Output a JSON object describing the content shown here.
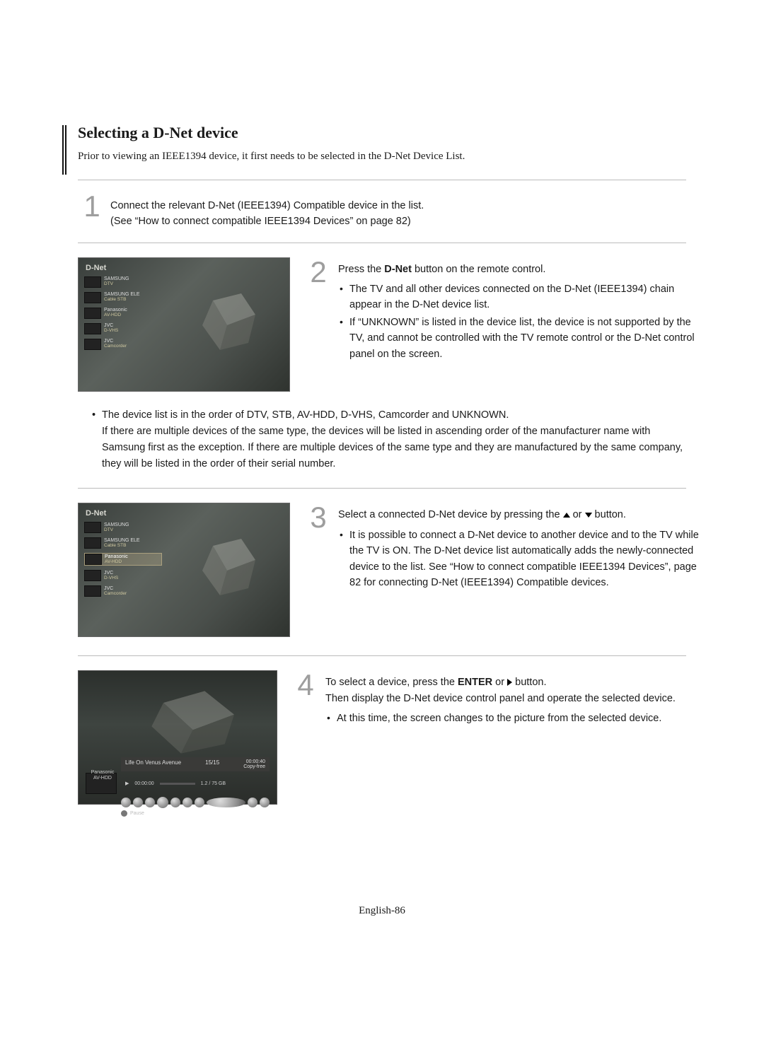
{
  "title": "Selecting a D-Net device",
  "intro": "Prior to viewing an IEEE1394 device, it first needs to be selected in the D-Net Device List.",
  "step1": {
    "num": "1",
    "line1": "Connect the relevant D-Net (IEEE1394) Compatible device in the list.",
    "line2": "(See “How to connect compatible IEEE1394 Devices” on page 82)"
  },
  "screenshot1": {
    "title": "D-Net",
    "devices": [
      {
        "name": "SAMSUNG",
        "sub": "DTV"
      },
      {
        "name": "SAMSUNG ELE",
        "sub": "Cable STB"
      },
      {
        "name": "Panasonic",
        "sub": "AV-HDD"
      },
      {
        "name": "JVC",
        "sub": "D-VHS"
      },
      {
        "name": "JVC",
        "sub": "Camcorder"
      }
    ]
  },
  "step2": {
    "num": "2",
    "lead_prefix": "Press the ",
    "lead_bold": "D-Net",
    "lead_suffix": " button on the remote control.",
    "bullet1": "The TV and all other devices connected on the D-Net (IEEE1394) chain appear in the D-Net device list.",
    "bullet2": "If “UNKNOWN” is listed in the device list, the device is not supported by the TV, and cannot be controlled with the TV remote control or the D-Net control panel on the screen."
  },
  "midnote": {
    "bullet": "The device list is in the order of DTV, STB, AV-HDD, D-VHS, Camcorder and UNKNOWN.",
    "cont": "If there are multiple devices of the same type, the devices will be listed in ascending order of the manufacturer name with Samsung first as the exception. If there are multiple devices of the same type and they are manufactured by the same company, they will be listed in the order of their serial number."
  },
  "screenshot2": {
    "title": "D-Net",
    "devices": [
      {
        "name": "SAMSUNG",
        "sub": "DTV"
      },
      {
        "name": "SAMSUNG ELE",
        "sub": "Cable STB"
      },
      {
        "name": "Panasonic",
        "sub": "AV-HDD"
      },
      {
        "name": "JVC",
        "sub": "D-VHS"
      },
      {
        "name": "JVC",
        "sub": "Camcorder"
      }
    ],
    "selected_index": 2
  },
  "step3": {
    "num": "3",
    "lead_prefix": "Select a connected D-Net device by pressing the",
    "lead_suffix_1": " or ",
    "lead_suffix_2": " button.",
    "bullet1": "It is possible to connect a D-Net device to another device and to the TV while the TV is ON. The D-Net device list automatically adds the newly-connected device to the list. See “How to connect compatible IEEE1394 Devices”, page 82 for connecting D-Net (IEEE1394) Compatible devices."
  },
  "screenshot3": {
    "title_line": "Life On Venus Avenue",
    "chapter": "15/15",
    "timecode": "00:00:40",
    "copy": "Copy-free",
    "pos": "00:00:00",
    "size": "1.2 / 75 GB",
    "device_name": "Panasonic",
    "device_sub": "AV-HDD",
    "state": "Pause"
  },
  "step4": {
    "num": "4",
    "lead_prefix": "To select a device, press the ",
    "lead_bold": "ENTER",
    "lead_mid": " or ",
    "lead_suffix": " button.",
    "line2": "Then display the D-Net device control panel and operate the selected device.",
    "bullet1": "At this time, the screen changes to the picture from the selected device."
  },
  "footer": "English-86"
}
